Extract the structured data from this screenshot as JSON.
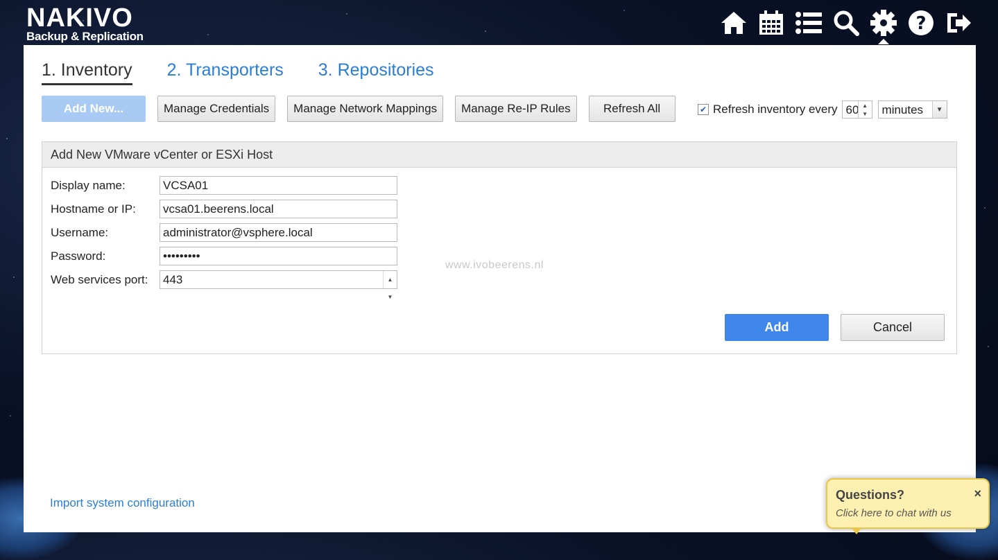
{
  "header": {
    "brand": "NAKIVO",
    "product": "Backup & Replication",
    "icons": [
      "home-icon",
      "calendar-icon",
      "list-icon",
      "search-icon",
      "gear-icon",
      "help-icon",
      "logout-icon"
    ]
  },
  "tabs": [
    {
      "label": "1. Inventory",
      "active": true
    },
    {
      "label": "2. Transporters",
      "active": false
    },
    {
      "label": "3. Repositories",
      "active": false
    }
  ],
  "toolbar": {
    "add_new": "Add New...",
    "manage_credentials": "Manage Credentials",
    "manage_network_mappings": "Manage Network Mappings",
    "manage_reip_rules": "Manage Re-IP Rules",
    "refresh_all": "Refresh All"
  },
  "refresh": {
    "checked": true,
    "label": "Refresh inventory every",
    "interval": "60",
    "unit": "minutes"
  },
  "form": {
    "title": "Add New VMware vCenter or ESXi Host",
    "fields": [
      {
        "label": "Display name:",
        "value": "VCSA01"
      },
      {
        "label": "Hostname or IP:",
        "value": "vcsa01.beerens.local"
      },
      {
        "label": "Username:",
        "value": "administrator@vsphere.local"
      },
      {
        "label": "Password:",
        "value": "•••••••••"
      },
      {
        "label": "Web services port:",
        "value": "443"
      }
    ],
    "add_label": "Add",
    "cancel_label": "Cancel"
  },
  "watermark": "www.ivobeerens.nl",
  "footer": {
    "import_link": "Import system configuration"
  },
  "chat": {
    "title": "Questions?",
    "close": "×",
    "subtitle": "Click here to chat with us"
  },
  "colors": {
    "accent": "#3f86ea",
    "link": "#2a7ed6",
    "disabled_button": "#a9cbf3",
    "chat_bg": "#fdf0b0"
  }
}
